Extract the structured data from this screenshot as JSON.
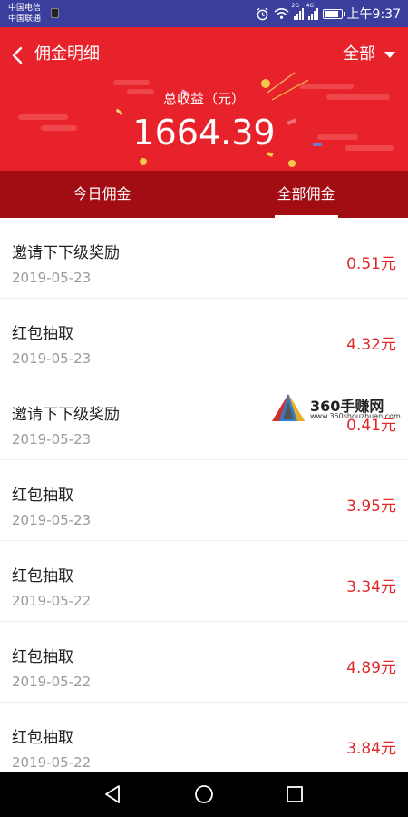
{
  "status_bar": {
    "carrier_1": "中国电信",
    "carrier_2": "中国联通",
    "network_1": "2G",
    "network_2": "4G",
    "time": "上午9:37"
  },
  "header": {
    "title": "佣金明细",
    "filter_label": "全部",
    "total_label": "总收益（元）",
    "total_value": "1664.39",
    "bg_color": "#e8222a"
  },
  "tabs": [
    {
      "label": "今日佣金",
      "active": false
    },
    {
      "label": "全部佣金",
      "active": true
    }
  ],
  "records": [
    {
      "title": "邀请下下级奖励",
      "date": "2019-05-23",
      "amount": "0.51元"
    },
    {
      "title": "红包抽取",
      "date": "2019-05-23",
      "amount": "4.32元"
    },
    {
      "title": "邀请下下级奖励",
      "date": "2019-05-23",
      "amount": "0.41元"
    },
    {
      "title": "红包抽取",
      "date": "2019-05-23",
      "amount": "3.95元"
    },
    {
      "title": "红包抽取",
      "date": "2019-05-22",
      "amount": "3.34元"
    },
    {
      "title": "红包抽取",
      "date": "2019-05-22",
      "amount": "4.89元"
    },
    {
      "title": "红包抽取",
      "date": "2019-05-22",
      "amount": "3.84元"
    }
  ],
  "watermark": {
    "name": "360手赚网",
    "url": "www.360shouzhuan.com"
  },
  "colors": {
    "accent": "#e8222a",
    "tab_bar": "#a10d12",
    "amount": "#e02a2a",
    "status_bar": "#3a3f9e"
  }
}
